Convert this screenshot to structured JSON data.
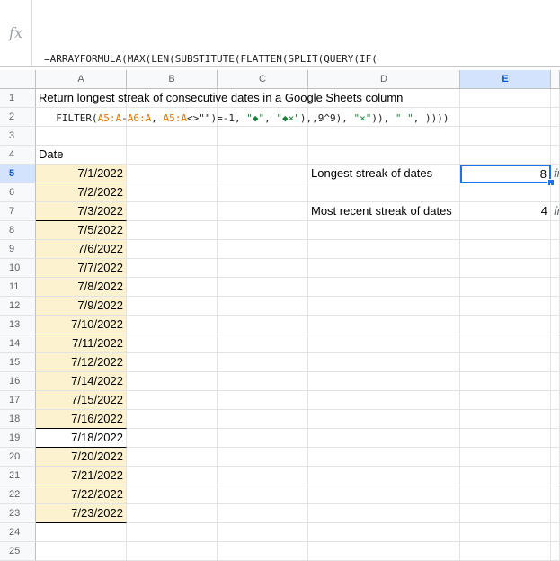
{
  "formula_bar": {
    "fx_icon": "fx-icon",
    "line1": "=ARRAYFORMULA(MAX(LEN(SUBSTITUTE(FLATTEN(SPLIT(QUERY(IF(",
    "line2_parts": [
      "FILTER(",
      "A5:A",
      "-",
      "A6:A",
      ", ",
      "A5:A",
      "<>",
      "\"\"",
      ")=-1, ",
      "\"◆\"",
      ", ",
      "\"◆×\"",
      "),,9^9), ",
      "\"×\"",
      ")), ",
      "\" \"",
      ", ))))"
    ]
  },
  "columns": [
    "A",
    "B",
    "C",
    "D",
    "E"
  ],
  "rows": [
    "1",
    "2",
    "3",
    "4",
    "5",
    "6",
    "7",
    "8",
    "9",
    "10",
    "11",
    "12",
    "13",
    "14",
    "15",
    "16",
    "17",
    "18",
    "19",
    "20",
    "21",
    "22",
    "23",
    "24",
    "25"
  ],
  "cells": {
    "title": "Return longest streak of consecutive dates in a Google Sheets column",
    "date_header": "Date",
    "dates": [
      "7/1/2022",
      "7/2/2022",
      "7/3/2022",
      "7/5/2022",
      "7/6/2022",
      "7/7/2022",
      "7/8/2022",
      "7/9/2022",
      "7/10/2022",
      "7/11/2022",
      "7/12/2022",
      "7/14/2022",
      "7/15/2022",
      "7/16/2022",
      "7/18/2022",
      "7/20/2022",
      "7/21/2022",
      "7/22/2022",
      "7/23/2022"
    ],
    "longest_label": "Longest streak of dates",
    "longest_value": "8",
    "longest_overflow": "fr",
    "recent_label": "Most recent streak of dates",
    "recent_value": "4",
    "recent_overflow": "fr"
  }
}
